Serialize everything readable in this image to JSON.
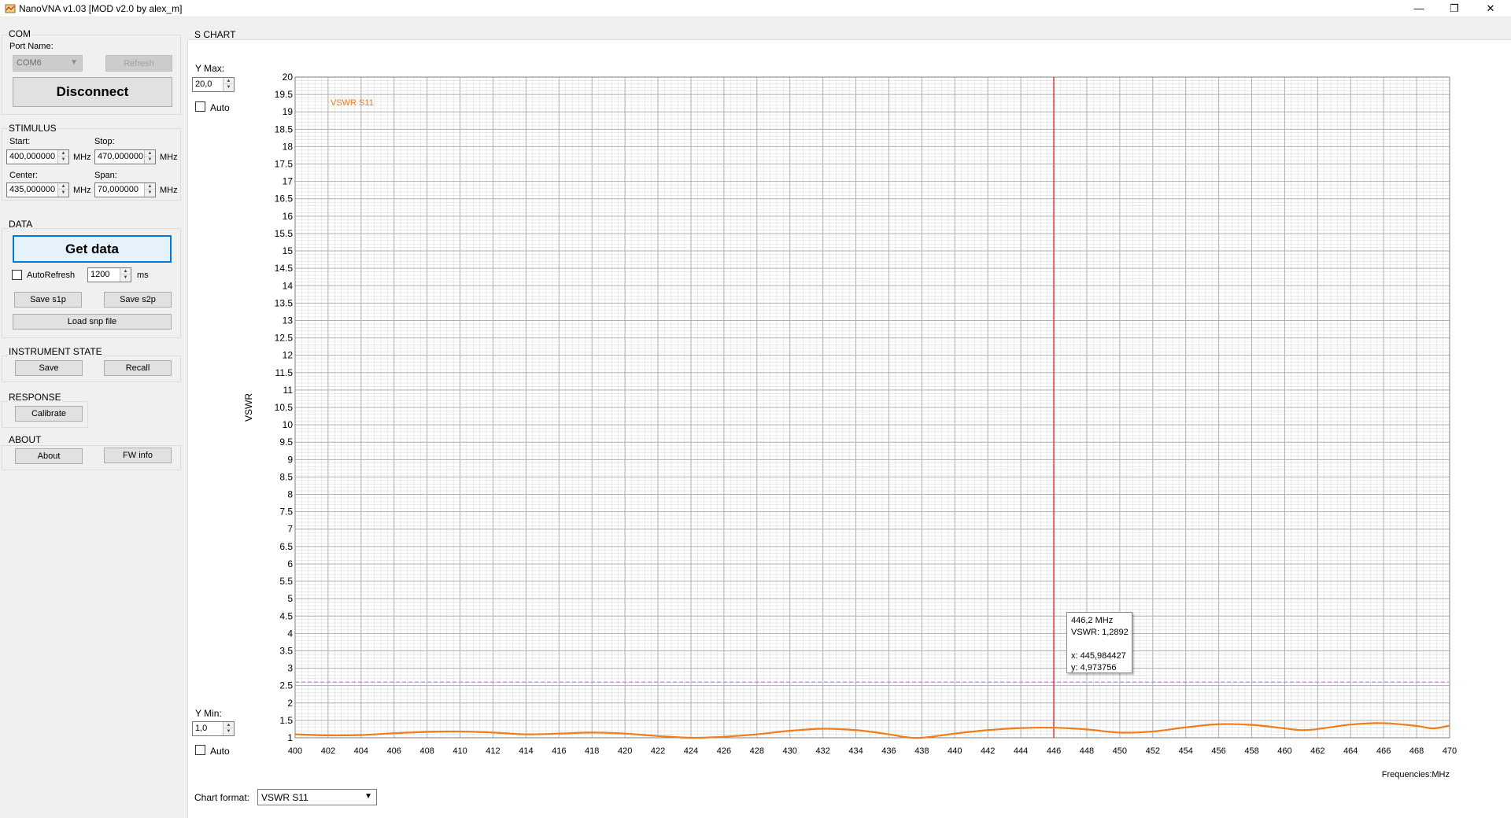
{
  "window": {
    "title": "NanoVNA v1.03 [MOD v2.0 by alex_m]",
    "controls": {
      "minimize": "—",
      "restore": "❐",
      "close": "✕"
    }
  },
  "com": {
    "group_label": "COM",
    "port_label": "Port Name:",
    "port_value": "COM6",
    "refresh_label": "Refresh",
    "disconnect_label": "Disconnect"
  },
  "stimulus": {
    "group_label": "STIMULUS",
    "start_label": "Start:",
    "start_value": "400,000000",
    "stop_label": "Stop:",
    "stop_value": "470,000000",
    "center_label": "Center:",
    "center_value": "435,000000",
    "span_label": "Span:",
    "span_value": "70,000000",
    "unit": "MHz"
  },
  "data_section": {
    "group_label": "DATA",
    "get_data_label": "Get data",
    "autorefresh_label": "AutoRefresh",
    "autorefresh_checked": false,
    "interval_value": "1200",
    "interval_unit": "ms",
    "save_s1p_label": "Save s1p",
    "save_s2p_label": "Save s2p",
    "load_snp_label": "Load snp file"
  },
  "instrument_state": {
    "group_label": "INSTRUMENT STATE",
    "save_label": "Save",
    "recall_label": "Recall"
  },
  "response": {
    "group_label": "RESPONSE",
    "calibrate_label": "Calibrate"
  },
  "about_section": {
    "group_label": "ABOUT",
    "about_label": "About",
    "fw_info_label": "FW info"
  },
  "s_chart": {
    "group_label": "S CHART",
    "ymax_label": "Y Max:",
    "ymax_value": "20,0",
    "ymin_label": "Y Min:",
    "ymin_value": "1,0",
    "auto_label": "Auto",
    "chart_format_label": "Chart format:",
    "chart_format_value": "VSWR S11"
  },
  "tooltip": {
    "freq": "446,2 MHz",
    "vswr_label": "VSWR:",
    "vswr_value": "1,2892",
    "x_text": "x: 445,984427",
    "y_text": "y: 4,973756"
  },
  "colors": {
    "trace": "#f07c1a",
    "marker": "#e8262b",
    "reference": "#f07ff0",
    "grid_major": "#b0b0b0",
    "grid_minor": "#dcdcdc"
  },
  "chart_data": {
    "type": "line",
    "title": "",
    "xlabel": "Frequencies:MHz",
    "ylabel": "VSWR",
    "xlim": [
      400,
      470
    ],
    "ylim": [
      1,
      20
    ],
    "x_ticks": [
      400,
      402,
      404,
      406,
      408,
      410,
      412,
      414,
      416,
      418,
      420,
      422,
      424,
      426,
      428,
      430,
      432,
      434,
      436,
      438,
      440,
      442,
      444,
      446,
      448,
      450,
      452,
      454,
      456,
      458,
      460,
      462,
      464,
      466,
      468,
      470
    ],
    "x_tick_labels": [
      "400",
      "402",
      "404",
      "406",
      "408",
      "410",
      "412",
      "414",
      "416",
      "418",
      "420",
      "422",
      "424",
      "426",
      "428",
      "430",
      "432",
      "434",
      "436",
      "438",
      "440",
      "442",
      "444",
      "446",
      "448",
      "450",
      "452",
      "454",
      "456",
      "458",
      "460",
      "462",
      "464",
      "466",
      "468",
      "470"
    ],
    "y_ticks": [
      1,
      1.5,
      2,
      2.5,
      3,
      3.5,
      4,
      4.5,
      5,
      5.5,
      6,
      6.5,
      7,
      7.5,
      8,
      8.5,
      9,
      9.5,
      10,
      10.5,
      11,
      11.5,
      12,
      12.5,
      13,
      13.5,
      14,
      14.5,
      15,
      15.5,
      16,
      16.5,
      17,
      17.5,
      18,
      18.5,
      19,
      19.5,
      20
    ],
    "y_tick_labels": [
      "1",
      "1.5",
      "2",
      "2.5",
      "3",
      "3.5",
      "4",
      "4.5",
      "5",
      "5.5",
      "6",
      "6.5",
      "7",
      "7.5",
      "8",
      "8.5",
      "9",
      "9.5",
      "10",
      "10.5",
      "11",
      "11.5",
      "12",
      "12.5",
      "13",
      "13.5",
      "14",
      "14.5",
      "15",
      "15.5",
      "16",
      "16.5",
      "17",
      "17.5",
      "18",
      "18.5",
      "19",
      "19.5",
      "20"
    ],
    "grid": true,
    "legend": "top-left",
    "series": [
      {
        "name": "VSWR S11",
        "x": [
          400,
          402,
          404,
          406,
          408,
          410,
          412,
          414,
          416,
          418,
          420,
          422,
          424,
          426,
          428,
          430,
          432,
          434,
          436,
          437,
          438,
          440,
          442,
          444,
          446,
          448,
          450,
          452,
          454,
          456,
          458,
          460,
          461,
          462,
          464,
          466,
          468,
          469,
          470
        ],
        "y": [
          1.1,
          1.07,
          1.08,
          1.13,
          1.17,
          1.18,
          1.15,
          1.1,
          1.12,
          1.15,
          1.12,
          1.05,
          1.0,
          1.03,
          1.1,
          1.2,
          1.26,
          1.22,
          1.1,
          1.02,
          1.0,
          1.12,
          1.22,
          1.28,
          1.29,
          1.24,
          1.15,
          1.18,
          1.3,
          1.39,
          1.37,
          1.27,
          1.22,
          1.25,
          1.38,
          1.42,
          1.34,
          1.27,
          1.35
        ]
      }
    ],
    "marker_x": 446,
    "reference_y": 2.6
  }
}
